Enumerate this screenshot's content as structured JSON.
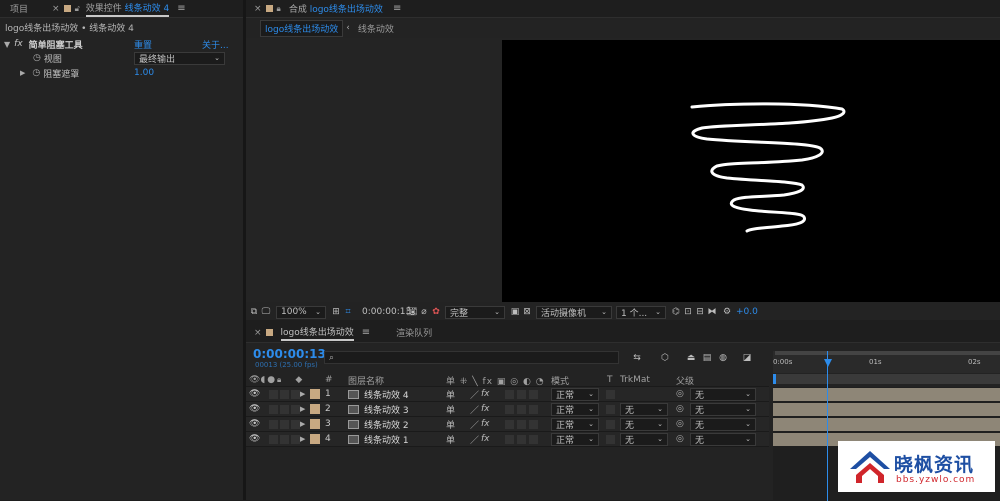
{
  "left_panel": {
    "tab_project": "项目",
    "tab_effects_prefix": "效果控件",
    "tab_effects_layer": "线条动效 4",
    "breadcrumb": "logo线条出场动效 • 线条动效 4",
    "effect_fx": "fx",
    "effect_name": "简单阻塞工具",
    "effect_reset": "重置",
    "effect_about": "关于...",
    "prop_view_label": "视图",
    "prop_view_value": "最终输出",
    "prop_choke_label": "阻塞遮罩",
    "prop_choke_value": "1.00"
  },
  "comp_panel": {
    "tab_label": "合成",
    "tab_comp_name": "logo线条出场动效",
    "sub_tab_active": "logo线条出场动效",
    "sub_tab_other": "线条动效",
    "zoom": "100%",
    "timecode": "0:00:00:13",
    "resolution": "完整",
    "camera": "活动摄像机",
    "views": "1 个...",
    "exposure": "+0.0"
  },
  "timeline": {
    "tab_comp": "logo线条出场动效",
    "tab_render": "渲染队列",
    "timecode": "0:00:00:13",
    "frame_info": "00013 (25.00 fps)",
    "search_placeholder": "",
    "header": {
      "num": "#",
      "layer_name": "图层名称",
      "mode": "模式",
      "t": "T",
      "trkmat": "TrkMat",
      "parent": "父级"
    },
    "ruler": [
      "0:00s",
      "01s",
      "02s"
    ],
    "layers": [
      {
        "num": "1",
        "name": "线条动效 4",
        "mode": "正常",
        "trkmat": "",
        "parent": "无"
      },
      {
        "num": "2",
        "name": "线条动效 3",
        "mode": "正常",
        "trkmat": "无",
        "parent": "无"
      },
      {
        "num": "3",
        "name": "线条动效 2",
        "mode": "正常",
        "trkmat": "无",
        "parent": "无"
      },
      {
        "num": "4",
        "name": "线条动效 1",
        "mode": "正常",
        "trkmat": "无",
        "parent": "无"
      }
    ]
  },
  "watermark": {
    "title": "晓枫资讯",
    "url": "bbs.yzwlo.com"
  },
  "colors": {
    "accent": "#2d8ceb",
    "label_tan": "#c8a982",
    "bar": "#8e8677"
  }
}
